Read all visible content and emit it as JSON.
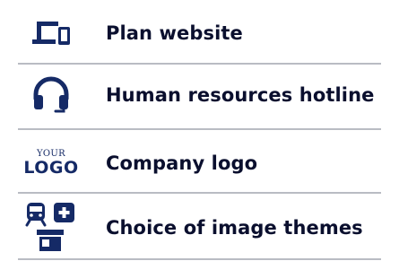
{
  "items": [
    {
      "icon": "devices-icon",
      "label": "Plan website"
    },
    {
      "icon": "headset-icon",
      "label": "Human resources hotline"
    },
    {
      "icon": "your-logo-icon",
      "label": "Company logo",
      "logo_top": "YOUR",
      "logo_bottom": "LOGO"
    },
    {
      "icon": "theme-icons-cluster",
      "label": "Choice of image themes"
    }
  ],
  "colors": {
    "icon": "#152a66",
    "text": "#0a0f2e",
    "divider": "#b9bcc3"
  }
}
